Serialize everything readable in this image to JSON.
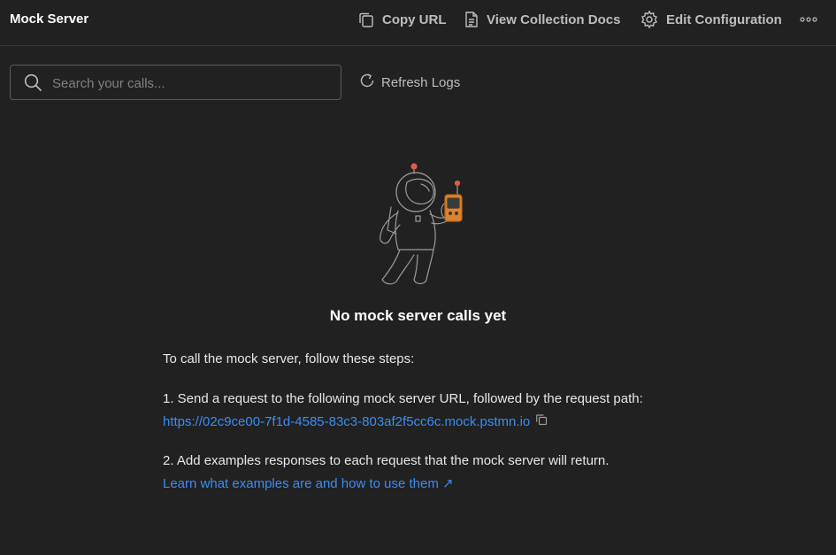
{
  "header": {
    "title": "Mock Server",
    "copy_url": "Copy URL",
    "view_docs": "View Collection Docs",
    "edit_config": "Edit Configuration"
  },
  "search": {
    "placeholder": "Search your calls..."
  },
  "refresh": {
    "label": "Refresh Logs"
  },
  "empty": {
    "title": "No mock server calls yet",
    "intro": "To call the mock server, follow these steps:",
    "step1": "1. Send a request to the following mock server URL, followed by the request path:",
    "url": "https://02c9ce00-7f1d-4585-83c3-803af2f5cc6c.mock.pstmn.io",
    "step2": "2. Add examples responses to each request that the mock server will return.",
    "learn_link": "Learn what examples are and how to use them ↗"
  },
  "colors": {
    "background": "#212121",
    "link": "#3b8cf5",
    "accent_orange": "#e0822b",
    "accent_red": "#e05a47"
  },
  "icons": [
    "copy-icon",
    "document-icon",
    "gear-icon",
    "more-icon",
    "search-icon",
    "refresh-icon",
    "astronaut-illustration",
    "copy-url-icon"
  ]
}
